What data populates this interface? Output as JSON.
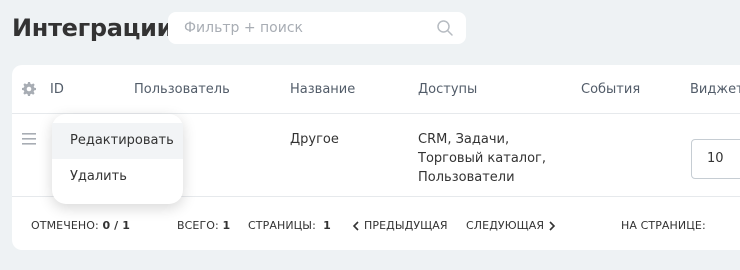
{
  "header": {
    "title": "Интеграции",
    "search_placeholder": "Фильтр + поиск"
  },
  "grid": {
    "columns": [
      "ID",
      "Пользователь",
      "Название",
      "Доступы",
      "События",
      "Виджеты"
    ],
    "rows": [
      {
        "id": "",
        "user": "",
        "name": "Другое",
        "access": [
          "CRM, Задачи,",
          "Торговый каталог,",
          "Пользователи"
        ],
        "events": "",
        "widgets": ""
      }
    ]
  },
  "context_menu": {
    "items": [
      "Редактировать",
      "Удалить"
    ]
  },
  "footer": {
    "marked_label": "Отмечено:",
    "marked_value": "0 / 1",
    "total_label": "Всего:",
    "total_value": "1",
    "pages_label": "Страницы:",
    "pages_value": "1",
    "prev_label": "Предыдущая",
    "next_label": "Следующая",
    "per_page_label": "На странице:",
    "per_page_value": "10"
  }
}
